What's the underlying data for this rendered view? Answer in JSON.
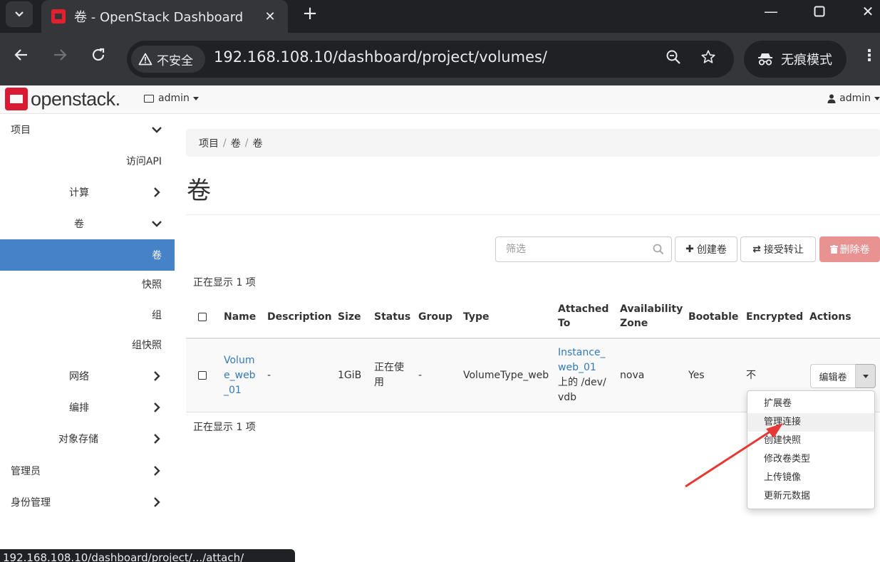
{
  "browser": {
    "tab_title": "卷 - OpenStack Dashboard",
    "security_label": "不安全",
    "url": "192.168.108.10/dashboard/project/volumes/",
    "incognito_label": "无痕模式",
    "status_url": "192.168.108.10/dashboard/project/.../attach/"
  },
  "header": {
    "logo_text": "openstack.",
    "project": "admin",
    "user": "admin"
  },
  "sidebar": {
    "items": [
      {
        "label": "项目"
      },
      {
        "label": "访问API"
      },
      {
        "label": "计算"
      },
      {
        "label": "卷"
      },
      {
        "label": "卷"
      },
      {
        "label": "快照"
      },
      {
        "label": "组"
      },
      {
        "label": "组快照"
      },
      {
        "label": "网络"
      },
      {
        "label": "编排"
      },
      {
        "label": "对象存储"
      },
      {
        "label": "管理员"
      },
      {
        "label": "身份管理"
      }
    ]
  },
  "breadcrumb": [
    "项目",
    "卷",
    "卷"
  ],
  "page_title": "卷",
  "toolbar": {
    "filter_placeholder": "筛选",
    "create_label": "创建卷",
    "accept_transfer_label": "接受转让",
    "delete_label": "删除卷"
  },
  "count_text": "正在显示 1 项",
  "table": {
    "columns": [
      "Name",
      "Description",
      "Size",
      "Status",
      "Group",
      "Type",
      "Attached To",
      "Availability Zone",
      "Bootable",
      "Encrypted",
      "Actions"
    ],
    "rows": [
      {
        "name": "Volume_web_01",
        "description": "-",
        "size": "1GiB",
        "status": "正在使用",
        "group": "-",
        "type": "VolumeType_web",
        "attached_instance": "Instance_web_01",
        "attached_suffix": "上的 /dev/vdb",
        "availability_zone": "nova",
        "bootable": "Yes",
        "encrypted": "不",
        "action_label": "编辑卷"
      }
    ]
  },
  "actions_menu": {
    "items": [
      "扩展卷",
      "管理连接",
      "创建快照",
      "修改卷类型",
      "上传镜像",
      "更新元数据"
    ],
    "highlighted": "管理连接"
  },
  "colors": {
    "active_nav": "#4682c8",
    "link": "#337ab7",
    "danger_button": "#e89292",
    "annotation_arrow": "#e53935"
  }
}
